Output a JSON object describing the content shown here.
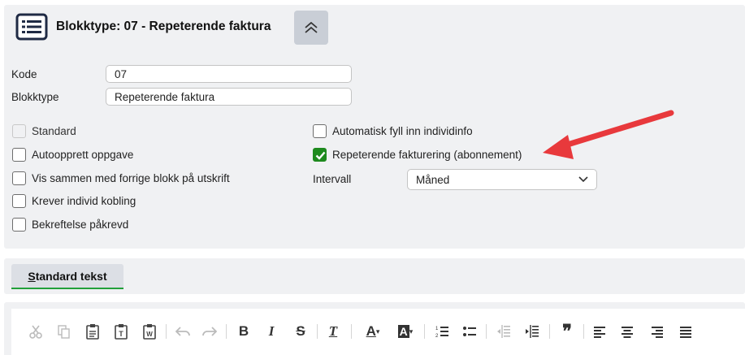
{
  "header": {
    "title": "Blokktype: 07 - Repeterende faktura",
    "menu_icon": "list-icon",
    "collapse_icon": "chevron-double-up-icon"
  },
  "form": {
    "kode": {
      "label": "Kode",
      "value": "07"
    },
    "blokktype": {
      "label": "Blokktype",
      "value": "Repeterende faktura"
    }
  },
  "checkboxes_left": [
    {
      "label": "Standard",
      "checked": false,
      "disabled": true
    },
    {
      "label": "Autoopprett oppgave",
      "checked": false
    },
    {
      "label": "Vis sammen med forrige blokk på utskrift",
      "checked": false
    },
    {
      "label": "Krever individ kobling",
      "checked": false
    },
    {
      "label": "Bekreftelse påkrevd",
      "checked": false
    }
  ],
  "checkboxes_right": [
    {
      "label": "Automatisk fyll inn individinfo",
      "checked": false
    },
    {
      "label": "Repeterende fakturering (abonnement)",
      "checked": true
    }
  ],
  "interval": {
    "label": "Intervall",
    "value": "Måned"
  },
  "tabs": {
    "standard_tekst": {
      "first": "S",
      "rest": "tandard tekst"
    }
  },
  "toolbar": {
    "icons": [
      "cut-icon",
      "copy-icon",
      "paste-icon",
      "paste-text-icon",
      "paste-word-icon",
      "undo-icon",
      "redo-icon",
      "bold-icon",
      "italic-icon",
      "strikethrough-icon",
      "remove-format-icon",
      "text-color-icon",
      "background-color-icon",
      "numbered-list-icon",
      "bulleted-list-icon",
      "outdent-icon",
      "indent-icon",
      "blockquote-icon",
      "align-left-icon",
      "align-center-icon",
      "align-right-icon",
      "justify-icon"
    ],
    "bold": "B",
    "italic": "I",
    "strike": "S",
    "remove": "T",
    "textcolor": "A",
    "bgcolor": "A",
    "quote": "❞"
  },
  "colors": {
    "accent_green": "#1e8a1e",
    "tab_underline": "#22a03a",
    "arrow_red": "#e8393c",
    "panel_bg": "#f0f1f3"
  }
}
